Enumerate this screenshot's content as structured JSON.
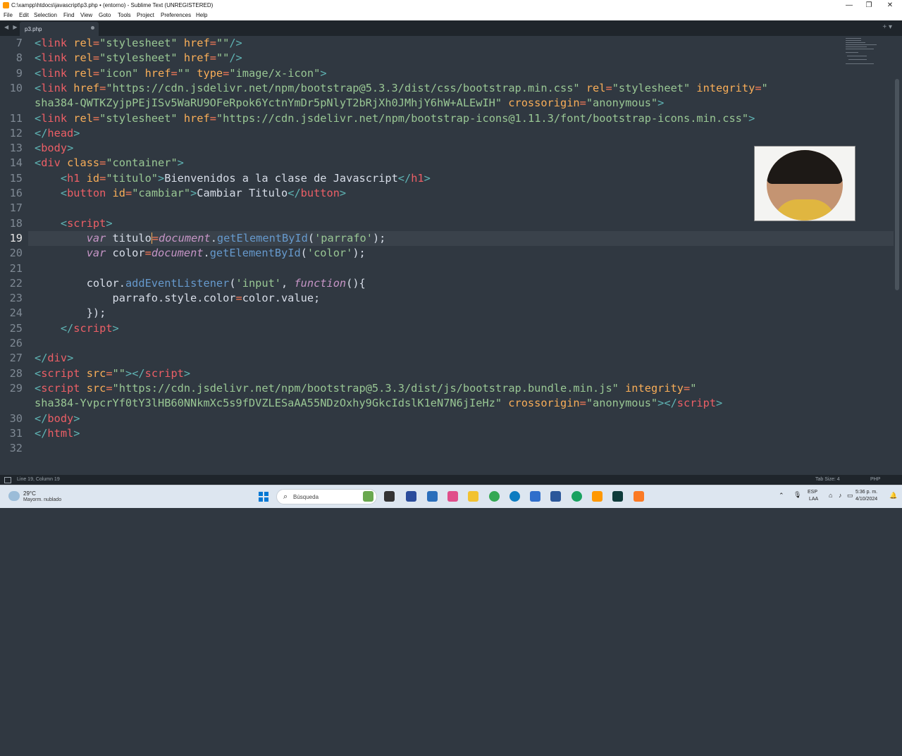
{
  "window": {
    "title": "C:\\xampp\\htdocs\\javascript\\p3.php • (entorno) - Sublime Text (UNREGISTERED)",
    "controls": [
      "—",
      "❐",
      "✕"
    ]
  },
  "menu": [
    "File",
    "Edit",
    "Selection",
    "Find",
    "View",
    "Goto",
    "Tools",
    "Project",
    "Preferences",
    "Help"
  ],
  "tabs": {
    "nav": "◀ ▶",
    "active_tab": "p3.php",
    "new_tab": "+ ▾"
  },
  "editor": {
    "line_numbers": [
      "7",
      "8",
      "9",
      "10",
      "",
      "11",
      "12",
      "13",
      "14",
      "15",
      "16",
      "17",
      "18",
      "19",
      "20",
      "21",
      "22",
      "23",
      "24",
      "25",
      "26",
      "27",
      "28",
      "29",
      "",
      "30",
      "31",
      "32"
    ],
    "current_line": "19",
    "colors": {
      "background": "#303841",
      "tag": "#ec5f66",
      "attribute": "#f9ae58",
      "string": "#99c794",
      "punctuation": "#5fb4b4",
      "keyword": "#c695c6",
      "function": "#6699cc",
      "text": "#d8dee9"
    }
  },
  "code": {
    "l7": {
      "lt": "<",
      "tag": "link",
      "a1": " rel",
      "eq1": "=",
      "v1": "\"stylesheet\"",
      "a2": " href",
      "eq2": "=",
      "v2": "\"\"",
      "end": "/>"
    },
    "l8": {
      "lt": "<",
      "tag": "link",
      "a1": " rel",
      "eq1": "=",
      "v1": "\"stylesheet\"",
      "a2": " href",
      "eq2": "=",
      "v2": "\"\"",
      "end": "/>"
    },
    "l9": {
      "lt": "<",
      "tag": "link",
      "a1": " rel",
      "eq1": "=",
      "v1": "\"icon\"",
      "a2": " href",
      "eq2": "=",
      "v2": "\"\"",
      "a3": " type",
      "eq3": "=",
      "v3": "\"image/x-icon\"",
      "end": ">"
    },
    "l10": {
      "lt": "<",
      "tag": "link",
      "a1": " href",
      "eq1": "=",
      "v1": "\"https://cdn.jsdelivr.net/npm/bootstrap@5.3.3/dist/css/bootstrap.min.css\"",
      "a2": " rel",
      "eq2": "=",
      "v2": "\"stylesheet\"",
      "a3": " integrity",
      "eq3": "=",
      "v3": "\""
    },
    "l10b": {
      "v3b": "sha384-QWTKZyjpPEjISv5WaRU9OFeRpok6YctnYmDr5pNlyT2bRjXh0JMhjY6hW+ALEwIH\"",
      "a4": " crossorigin",
      "eq4": "=",
      "v4": "\"anonymous\"",
      "end": ">"
    },
    "l11": {
      "lt": "<",
      "tag": "link",
      "a1": " rel",
      "eq1": "=",
      "v1": "\"stylesheet\"",
      "a2": " href",
      "eq2": "=",
      "v2": "\"https://cdn.jsdelivr.net/npm/bootstrap-icons@1.11.3/font/bootstrap-icons.min.css\"",
      "end": ">"
    },
    "l12": {
      "lt": "</",
      "tag": "head",
      "end": ">"
    },
    "l13": {
      "lt": "<",
      "tag": "body",
      "end": ">"
    },
    "l14": {
      "lt": "<",
      "tag": "div",
      "a1": " class",
      "eq1": "=",
      "v1": "\"container\"",
      "end": ">"
    },
    "l15": {
      "indent": "    ",
      "lt": "<",
      "tag": "h1",
      "a1": " id",
      "eq1": "=",
      "v1": "\"titulo\"",
      "gt": ">",
      "text": "Bienvenidos a la clase de Javascript",
      "lt2": "</",
      "tag2": "h1",
      "end": ">"
    },
    "l16": {
      "indent": "    ",
      "lt": "<",
      "tag": "button",
      "a1": " id",
      "eq1": "=",
      "v1": "\"cambiar\"",
      "gt": ">",
      "text": "Cambiar Titulo",
      "lt2": "</",
      "tag2": "button",
      "end": ">"
    },
    "l18": {
      "indent": "    ",
      "lt": "<",
      "tag": "script",
      "end": ">"
    },
    "l19": {
      "indent": "        ",
      "kw": "var",
      "name": " titulo",
      "eq": "=",
      "obj": "document",
      "dot": ".",
      "fn": "getElementById",
      "p1": "(",
      "str": "'parrafo'",
      "p2": ");"
    },
    "l20": {
      "indent": "        ",
      "kw": "var",
      "name": " color",
      "eq": "=",
      "obj": "document",
      "dot": ".",
      "fn": "getElementById",
      "p1": "(",
      "str": "'color'",
      "p2": ");"
    },
    "l22": {
      "indent": "        ",
      "obj": "color",
      "dot": ".",
      "fn": "addEventListener",
      "p1": "(",
      "str": "'input'",
      "comma": ", ",
      "kw": "function",
      "p2": "(){"
    },
    "l23": {
      "indent": "            ",
      "text": "parrafo.style.color",
      "eq": "=",
      "text2": "color.value;"
    },
    "l24": {
      "indent": "        ",
      "text": "});"
    },
    "l25": {
      "indent": "    ",
      "lt": "</",
      "tag": "script",
      "end": ">"
    },
    "l27": {
      "lt": "</",
      "tag": "div",
      "end": ">"
    },
    "l28": {
      "lt": "<",
      "tag": "script",
      "a1": " src",
      "eq1": "=",
      "v1": "\"\"",
      "gt": ">",
      "lt2": "</",
      "tag2": "script",
      "end": ">"
    },
    "l29": {
      "lt": "<",
      "tag": "script",
      "a1": " src",
      "eq1": "=",
      "v1": "\"https://cdn.jsdelivr.net/npm/bootstrap@5.3.3/dist/js/bootstrap.bundle.min.js\"",
      "a2": " integrity",
      "eq2": "=",
      "v2": "\""
    },
    "l29b": {
      "v2b": "sha384-YvpcrYf0tY3lHB60NNkmXc5s9fDVZLESaAA55NDzOxhy9GkcIdslK1eN7N6jIeHz\"",
      "a3": " crossorigin",
      "eq3": "=",
      "v3": "\"anonymous\"",
      "gt": ">",
      "lt2": "</",
      "tag2": "script",
      "end": ">"
    },
    "l30": {
      "lt": "</",
      "tag": "body",
      "end": ">"
    },
    "l31": {
      "lt": "</",
      "tag": "html",
      "end": ">"
    }
  },
  "statusbar": {
    "position": "Line 19, Column 19",
    "tab_size": "Tab Size: 4",
    "syntax": "PHP"
  },
  "taskbar": {
    "weather_temp": "29°C",
    "weather_desc": "Mayorm. nublado",
    "search_placeholder": "Búsqueda",
    "lang": "ESP",
    "lang2": "LAA",
    "time": "5:36 p. m.",
    "date": "4/10/2024"
  }
}
